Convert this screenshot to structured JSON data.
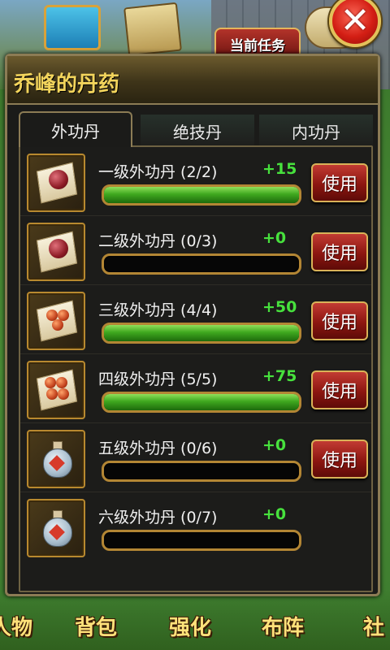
{
  "background": {
    "task_button": "当前任务",
    "bottom_nav": [
      {
        "label": "人物"
      },
      {
        "label": "背包"
      },
      {
        "label": "强化"
      },
      {
        "label": "布阵"
      },
      {
        "label": "社"
      }
    ]
  },
  "dialog": {
    "title": "乔峰的丹药",
    "close_icon": "close-icon",
    "tabs": [
      {
        "label": "外功丹",
        "active": true
      },
      {
        "label": "绝技丹",
        "active": false
      },
      {
        "label": "内功丹",
        "active": false
      }
    ],
    "items": [
      {
        "label": "一级外功丹 (2/2)",
        "bonus": "+15",
        "progress": 1.0,
        "icon": "red-pill-icon",
        "button": "使用"
      },
      {
        "label": "二级外功丹 (0/3)",
        "bonus": "+0",
        "progress": 0.0,
        "icon": "red-pill-icon",
        "button": "使用"
      },
      {
        "label": "三级外功丹 (4/4)",
        "bonus": "+50",
        "progress": 1.0,
        "icon": "orange-pills-icon",
        "button": "使用"
      },
      {
        "label": "四级外功丹 (5/5)",
        "bonus": "+75",
        "progress": 1.0,
        "icon": "orange-pills-icon",
        "button": "使用"
      },
      {
        "label": "五级外功丹 (0/6)",
        "bonus": "+0",
        "progress": 0.0,
        "icon": "potion-bottle-icon",
        "button": "使用"
      },
      {
        "label": "六级外功丹 (0/7)",
        "bonus": "+0",
        "progress": 0.0,
        "icon": "potion-bottle-icon",
        "button": null
      }
    ]
  },
  "colors": {
    "title": "#f2d45c",
    "bonus": "#47e13d",
    "progress_fill": "#3fa81f",
    "button": "#8c1610",
    "frame": "#8c7c55"
  }
}
